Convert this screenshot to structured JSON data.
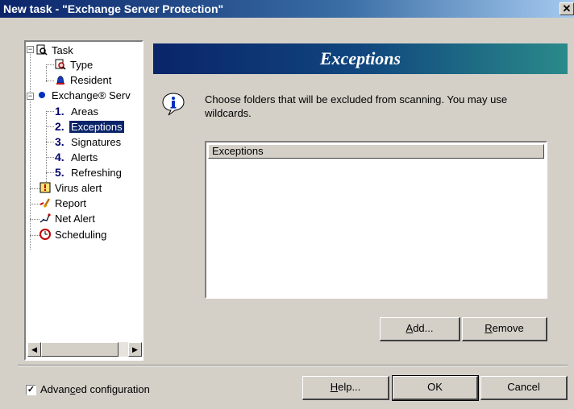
{
  "window": {
    "title": "New task - \"Exchange Server Protection\"",
    "close_glyph": "✕"
  },
  "tree": {
    "items": [
      {
        "label": "Task",
        "icon": "magnifier-document-icon"
      },
      {
        "label": "Type",
        "icon": "magnifier-document-icon"
      },
      {
        "label": "Resident",
        "icon": "bell-icon"
      },
      {
        "label": "Exchange® Serv",
        "icon": "blue-dot-icon"
      },
      {
        "num": "1.",
        "label": "Areas"
      },
      {
        "num": "2.",
        "label": "Exceptions",
        "selected": true
      },
      {
        "num": "3.",
        "label": "Signatures"
      },
      {
        "num": "4.",
        "label": "Alerts"
      },
      {
        "num": "5.",
        "label": "Refreshing"
      },
      {
        "label": "Virus alert",
        "icon": "alert-icon"
      },
      {
        "label": "Report",
        "icon": "report-icon"
      },
      {
        "label": "Net Alert",
        "icon": "network-icon"
      },
      {
        "label": "Scheduling",
        "icon": "clock-icon"
      }
    ]
  },
  "banner": {
    "title": "Exceptions"
  },
  "description": "Choose folders that will be excluded from scanning. You may use wildcards.",
  "exceptions_list": {
    "header": "Exceptions",
    "rows": []
  },
  "buttons": {
    "add": {
      "prefix": "",
      "mnemonic": "A",
      "rest": "dd..."
    },
    "remove": {
      "prefix": "",
      "mnemonic": "R",
      "rest": "emove"
    },
    "help": {
      "prefix": "",
      "mnemonic": "H",
      "rest": "elp..."
    },
    "ok": "OK",
    "cancel": "Cancel"
  },
  "advanced": {
    "checked": true,
    "label_prefix": "Advan",
    "label_mnemonic": "c",
    "label_rest": "ed configuration"
  },
  "colors": {
    "title_bar": "#0a246a",
    "selection": "#0a246a",
    "dialog_bg": "#d4d0c8"
  }
}
